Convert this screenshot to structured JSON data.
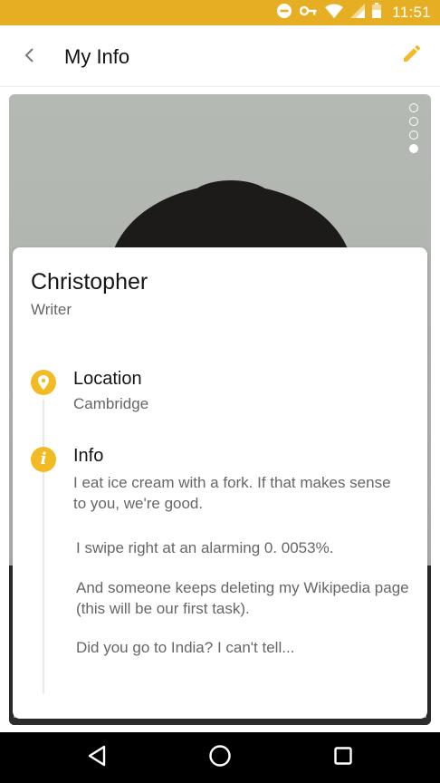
{
  "status_bar": {
    "time": "11:51",
    "color": "#E6AE23",
    "icons": [
      "do-not-disturb-icon",
      "key-icon",
      "wifi-icon",
      "signal-icon",
      "battery-icon"
    ]
  },
  "app_bar": {
    "title": "My Info",
    "back_icon": "chevron-left-icon",
    "edit_icon": "pencil-icon",
    "accent_color": "#F2BB26"
  },
  "photo": {
    "page_count": 4,
    "active_page_index": 3
  },
  "profile": {
    "name": "Christopher",
    "job": "Writer",
    "location": {
      "title": "Location",
      "value": "Cambridge",
      "icon": "location-pin-icon"
    },
    "info": {
      "title": "Info",
      "icon": "info-icon",
      "intro": "I eat ice cream with a fork. If that makes sense to you, we're good.",
      "paragraphs": [
        "I swipe right at an alarming 0. 0053%.",
        "And someone keeps deleting my Wikipedia page (this will be our first task).",
        "Did you go to India? I can't tell..."
      ]
    }
  },
  "nav_bar": {
    "buttons": [
      "back-triangle-icon",
      "home-circle-icon",
      "recents-square-icon"
    ]
  }
}
